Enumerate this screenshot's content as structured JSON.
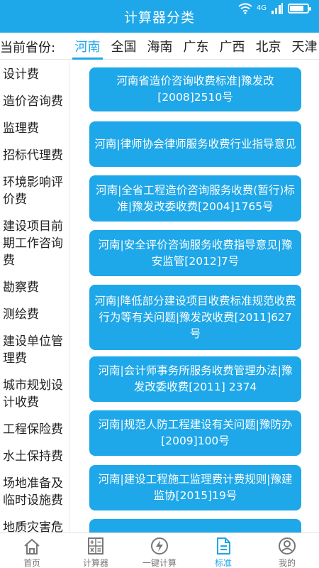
{
  "header": {
    "title": "计算器分类",
    "network_label": "4G"
  },
  "status_bar": {
    "battery_level_percent": 80
  },
  "province": {
    "label": "当前省份:",
    "tabs": [
      "河南",
      "全国",
      "海南",
      "广东",
      "广西",
      "北京",
      "天津"
    ],
    "active_index": 0
  },
  "sidebar": {
    "items": [
      "设计费",
      "造价咨询费",
      "监理费",
      "招标代理费",
      "环境影响评价费",
      "建设项目前期工作咨询费",
      "勘察费",
      "测绘费",
      "建设单位管理费",
      "城市规划设计收费",
      "工程保险费",
      "水土保持费",
      "场地准备及临时设施费",
      "地质灾害危险性评估费"
    ]
  },
  "documents": [
    "河南省造价咨询收费标准|豫发改[2008]2510号",
    "河南|律师协会律师服务收费行业指导意见",
    "河南|全省工程造价咨询服务收费(暂行)标准|豫发改委收费[2004]1765号",
    "河南|安全评价咨询服务收费指导意见|豫安监管[2012]7号",
    "河南|降低部分建设项目收费标准规范收费行为等有关问题|豫发改收费[2011]627号",
    "河南|会计师事务所服务收费管理办法|豫发改委收费[2011] 2374",
    "河南|规范人防工程建设有关问题|豫防办[2009]100号",
    "河南|建设工程施工监理费计费规则|豫建监协[2015]19号",
    ""
  ],
  "bottom_nav": {
    "items": [
      {
        "label": "首页",
        "icon": "home-icon"
      },
      {
        "label": "计算器",
        "icon": "calculator-icon"
      },
      {
        "label": "一键计算",
        "icon": "lightning-icon"
      },
      {
        "label": "标准",
        "icon": "document-icon"
      },
      {
        "label": "我的",
        "icon": "user-icon"
      }
    ],
    "active_index": 3
  },
  "colors": {
    "accent": "#1ea7e9",
    "text": "#222222",
    "nav_inactive": "#777777"
  }
}
